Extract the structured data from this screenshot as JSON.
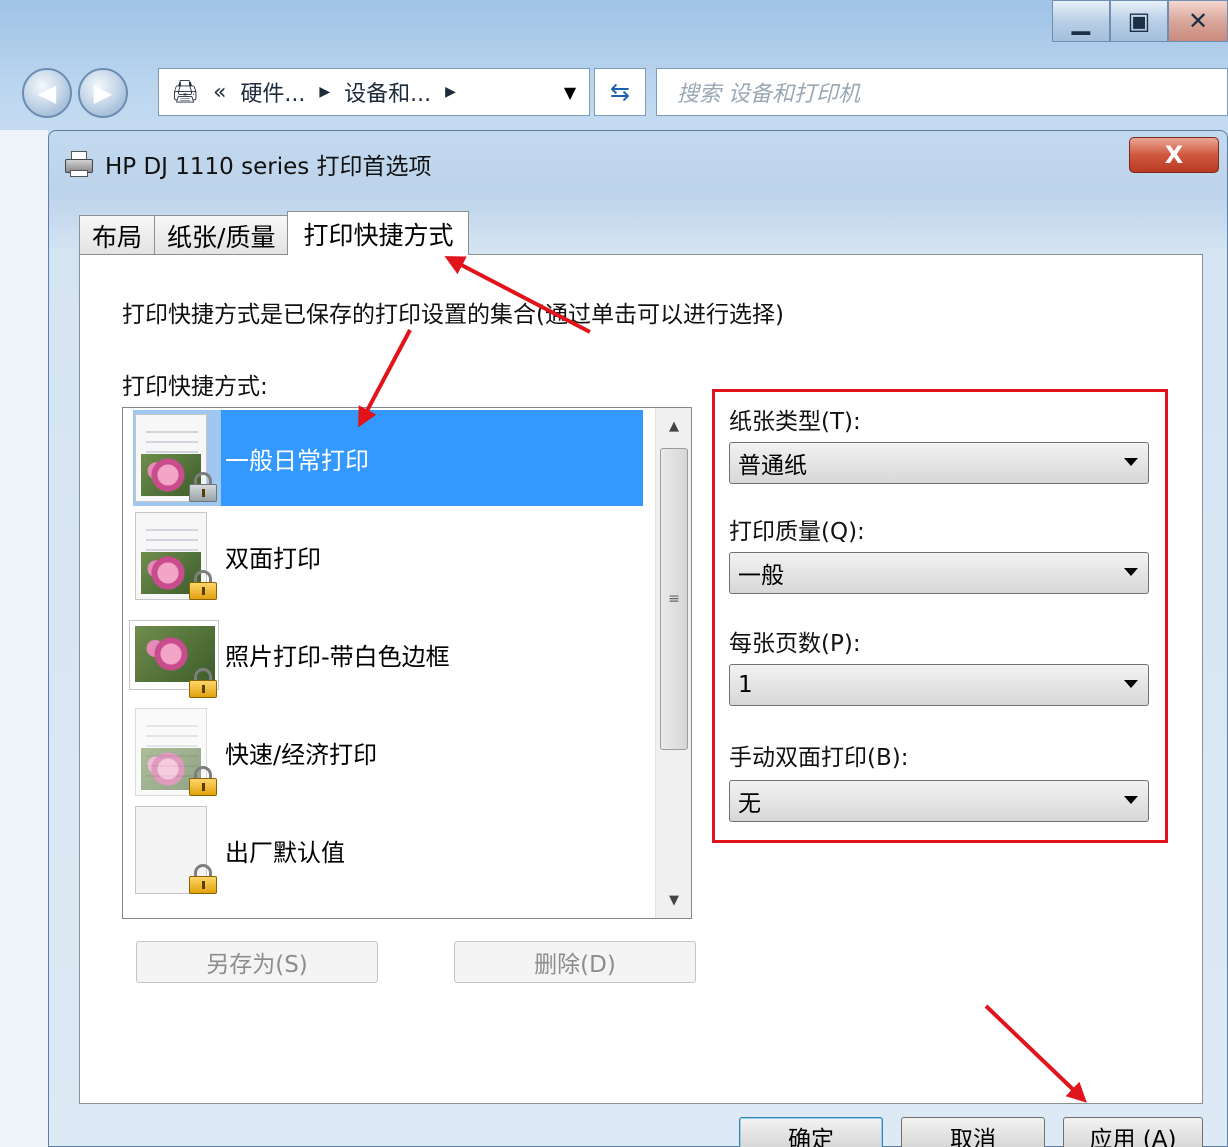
{
  "explorer": {
    "address_items": [
      "«",
      "硬件...",
      "设备和..."
    ],
    "search_placeholder": "搜索 设备和打印机",
    "window_controls": [
      "minimize-icon",
      "maximize-icon",
      "close-icon"
    ]
  },
  "dialog": {
    "title": "HP DJ 1110 series 打印首选项",
    "close_label": "X",
    "tabs": [
      {
        "label": "布局",
        "active": false
      },
      {
        "label": "纸张/质量",
        "active": false
      },
      {
        "label": "打印快捷方式",
        "active": true
      }
    ],
    "description": "打印快捷方式是已保存的打印设置的集合(通过单击可以进行选择)",
    "list_label": "打印快捷方式:",
    "shortcuts": [
      {
        "label": "一般日常打印",
        "selected": true,
        "icon": "document-photo-icon"
      },
      {
        "label": "双面打印",
        "selected": false,
        "icon": "duplex-icon"
      },
      {
        "label": "照片打印-带白色边框",
        "selected": false,
        "icon": "photo-icon"
      },
      {
        "label": "快速/经济打印",
        "selected": false,
        "icon": "fast-print-icon"
      },
      {
        "label": "出厂默认值",
        "selected": false,
        "icon": "blank-page-icon"
      }
    ],
    "save_as_label": "另存为(S)",
    "delete_label": "删除(D)",
    "settings": {
      "paper_type_label": "纸张类型(T):",
      "paper_type_value": "普通纸",
      "print_quality_label": "打印质量(Q):",
      "print_quality_value": "一般",
      "pages_per_sheet_label": "每张页数(P):",
      "pages_per_sheet_value": "1",
      "manual_duplex_label": "手动双面打印(B):",
      "manual_duplex_value": "无"
    },
    "footer": {
      "ok_label": "确定",
      "cancel_label": "取消",
      "apply_label": "应用 (A)"
    }
  },
  "colors": {
    "selection": "#3399ff",
    "highlight_box": "#e1141b",
    "arrow": "#e1141b"
  }
}
